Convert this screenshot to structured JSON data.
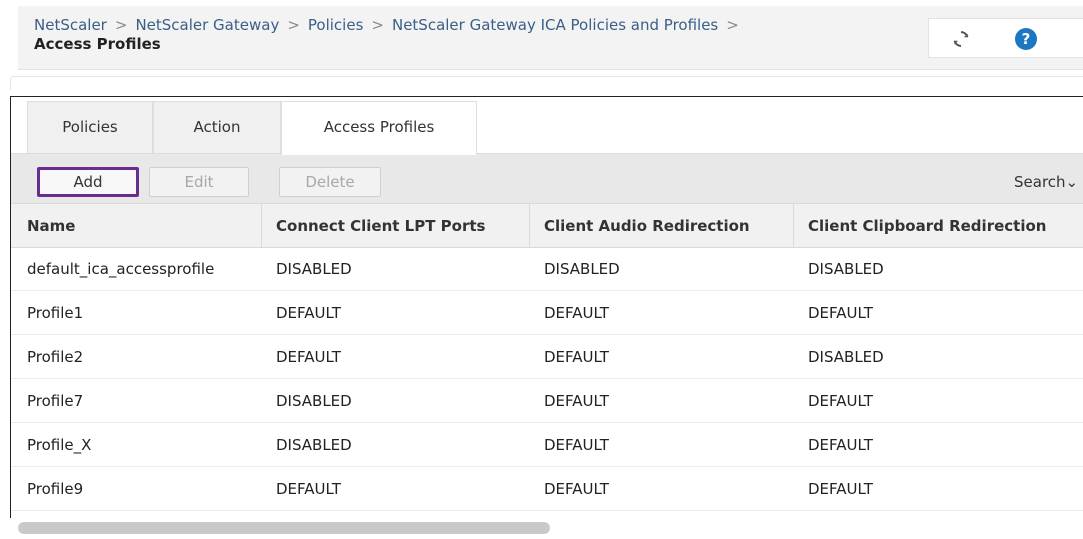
{
  "breadcrumb": {
    "items": [
      "NetScaler",
      "NetScaler Gateway",
      "Policies",
      "NetScaler Gateway ICA Policies and Profiles"
    ],
    "current": "Access Profiles"
  },
  "header": {
    "refresh_icon": "refresh-icon",
    "help_icon": "help-icon",
    "help_glyph": "?"
  },
  "tabs": [
    {
      "label": "Policies"
    },
    {
      "label": "Action"
    },
    {
      "label": "Access Profiles",
      "active": true
    }
  ],
  "toolbar": {
    "add_label": "Add",
    "edit_label": "Edit",
    "delete_label": "Delete",
    "search_label": "Search",
    "accent_color": "#6a2c91"
  },
  "table": {
    "columns": [
      "Name",
      "Connect Client LPT Ports",
      "Client Audio Redirection",
      "Client Clipboard Redirection"
    ],
    "rows": [
      [
        "default_ica_accessprofile",
        "DISABLED",
        "DISABLED",
        "DISABLED"
      ],
      [
        "Profile1",
        "DEFAULT",
        "DEFAULT",
        "DEFAULT"
      ],
      [
        "Profile2",
        "DEFAULT",
        "DEFAULT",
        "DISABLED"
      ],
      [
        "Profile7",
        "DISABLED",
        "DEFAULT",
        "DEFAULT"
      ],
      [
        "Profile_X",
        "DISABLED",
        "DEFAULT",
        "DEFAULT"
      ],
      [
        "Profile9",
        "DEFAULT",
        "DEFAULT",
        "DEFAULT"
      ]
    ]
  }
}
